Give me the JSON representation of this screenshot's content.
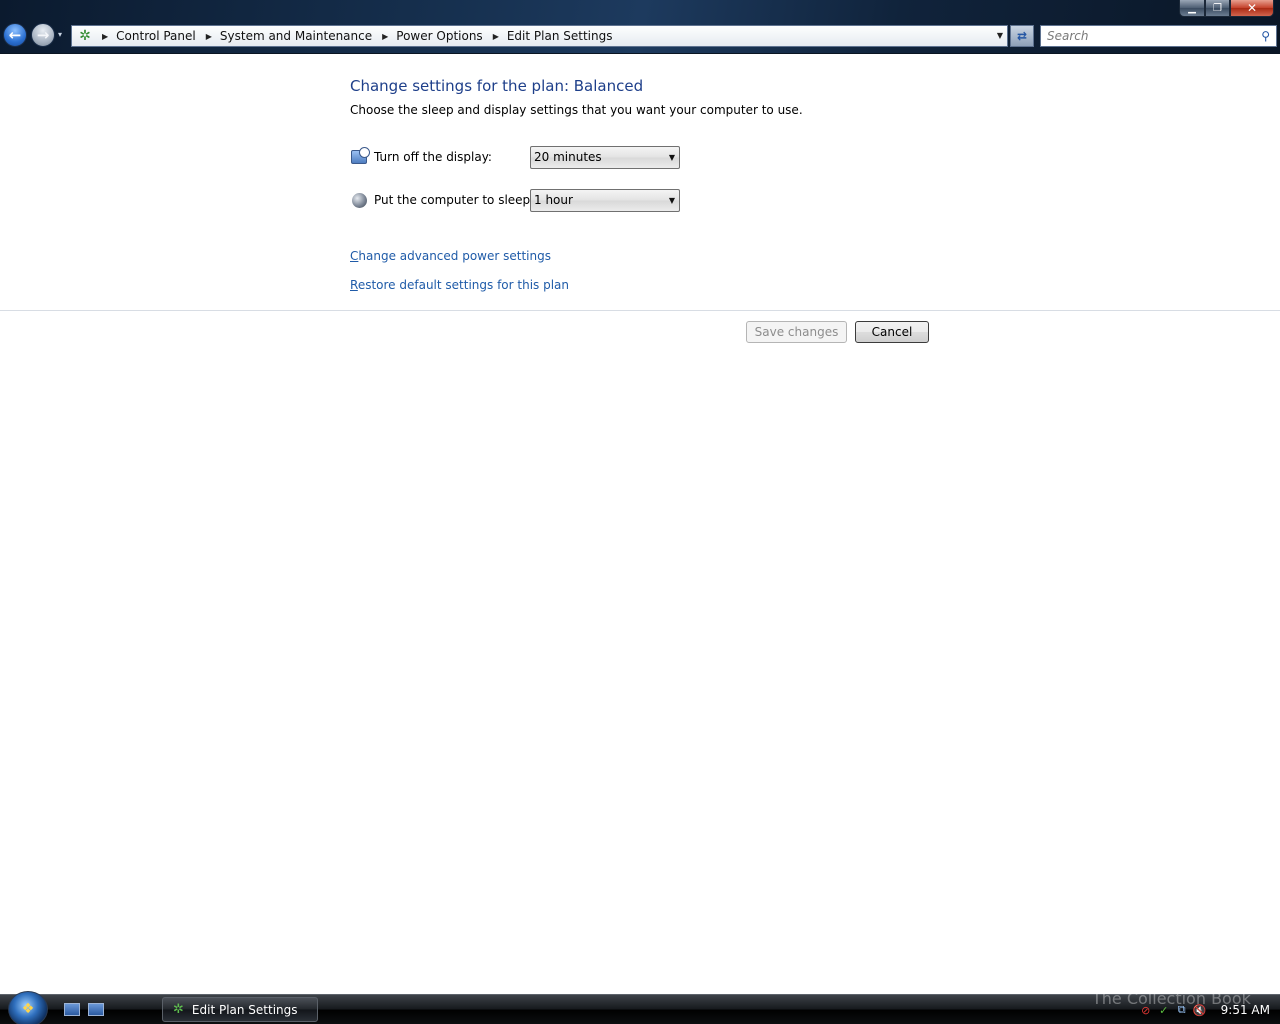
{
  "window": {
    "controls": {
      "minimize": "▁",
      "maximize": "❐",
      "close": "✕"
    }
  },
  "navigation": {
    "back_glyph": "←",
    "forward_glyph": "→",
    "history_glyph": "▾"
  },
  "address_bar": {
    "icon": "control-panel-icon",
    "breadcrumbs": [
      {
        "label": "Control Panel"
      },
      {
        "label": "System and Maintenance"
      },
      {
        "label": "Power Options"
      },
      {
        "label": "Edit Plan Settings"
      }
    ],
    "arrow": "▶",
    "dropdown_glyph": "▼",
    "refresh_glyph": "⇄"
  },
  "search": {
    "placeholder": "Search",
    "icon": "⚲"
  },
  "main": {
    "title": "Change settings for the plan: Balanced",
    "subtitle": "Choose the sleep and display settings that you want your computer to use.",
    "settings": [
      {
        "label": "Turn off the display:",
        "value": "20 minutes",
        "icon": "display-icon"
      },
      {
        "label": "Put the computer to sleep:",
        "value": "1 hour",
        "icon": "sleep-icon"
      }
    ],
    "select_arrow": "▼",
    "links": {
      "advanced_access_key": "C",
      "advanced_rest": "hange advanced power settings",
      "restore_access_key": "R",
      "restore_rest": "estore default settings for this plan"
    },
    "buttons": {
      "save": "Save changes",
      "cancel": "Cancel"
    }
  },
  "taskbar": {
    "task_label": "Edit Plan Settings",
    "clock": "9:51 AM",
    "watermark": "The Collection Book",
    "tray": {
      "defender": "⊘",
      "security": "✓",
      "network": "⧉",
      "volume": "🔇"
    }
  },
  "colors": {
    "title_blue": "#1e3f8a",
    "link_blue": "#1f5ba8"
  }
}
